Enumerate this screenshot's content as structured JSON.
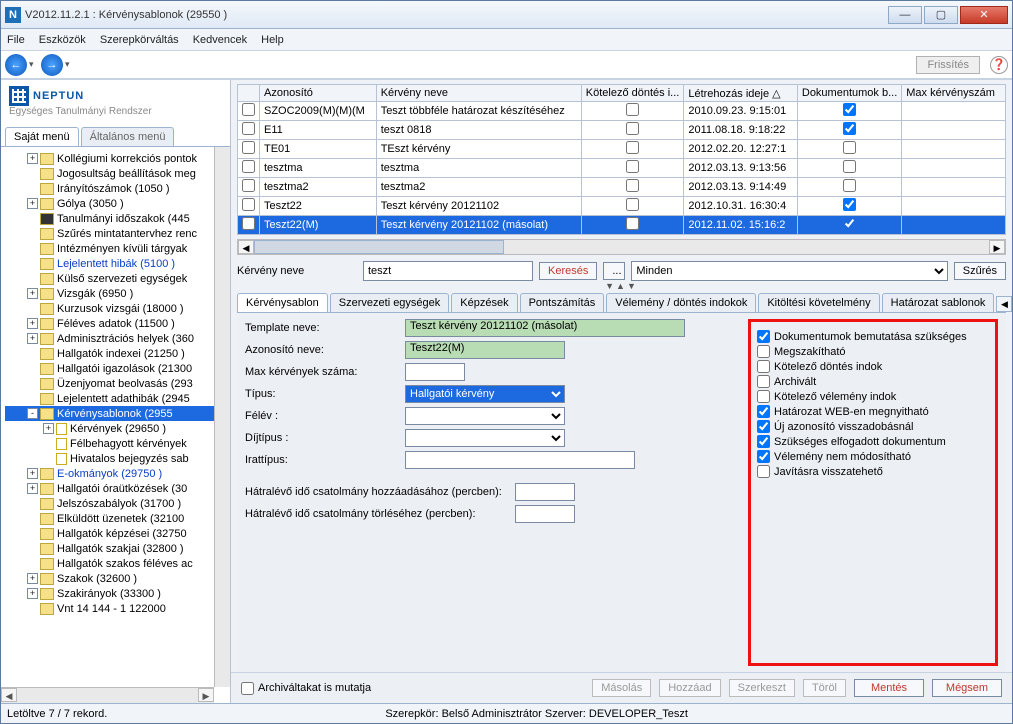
{
  "title": "V2012.11.2.1 : Kérvénysablonok (29550  )",
  "menu": [
    "File",
    "Eszközök",
    "Szerepkörváltás",
    "Kedvencek",
    "Help"
  ],
  "toolbar": {
    "refresh": "Frissítés"
  },
  "logo": {
    "name": "NEPTUN",
    "sub": "Egységes Tanulmányi Rendszer"
  },
  "left_tabs": [
    "Saját menü",
    "Általános menü"
  ],
  "tree": [
    {
      "pm": "+",
      "ic": "fld",
      "lbl": "Kollégiumi korrekciós pontok",
      "ind": 1
    },
    {
      "pm": "",
      "ic": "fld",
      "lbl": "Jogosultság beállítások meg",
      "ind": 1
    },
    {
      "pm": "",
      "ic": "fld",
      "lbl": "Irányítószámok (1050  )",
      "ind": 1
    },
    {
      "pm": "+",
      "ic": "fld",
      "lbl": "Gólya (3050  )",
      "ind": 1
    },
    {
      "pm": "",
      "ic": "blk",
      "lbl": "Tanulmányi időszakok (445",
      "ind": 1
    },
    {
      "pm": "",
      "ic": "fld",
      "lbl": "Szűrés mintatantervhez renc",
      "ind": 1
    },
    {
      "pm": "",
      "ic": "fld",
      "lbl": "Intézményen kívüli tárgyak",
      "ind": 1
    },
    {
      "pm": "",
      "ic": "fld",
      "lbl": "Lejelentett hibák (5100  )",
      "ind": 1,
      "blue": true
    },
    {
      "pm": "",
      "ic": "fld",
      "lbl": "Külső szervezeti egységek",
      "ind": 1
    },
    {
      "pm": "+",
      "ic": "fld",
      "lbl": "Vizsgák (6950  )",
      "ind": 1
    },
    {
      "pm": "",
      "ic": "fld",
      "lbl": "Kurzusok vizsgái (18000  )",
      "ind": 1
    },
    {
      "pm": "+",
      "ic": "fld",
      "lbl": "Féléves adatok (11500  )",
      "ind": 1
    },
    {
      "pm": "+",
      "ic": "fld",
      "lbl": "Adminisztrációs helyek (360",
      "ind": 1
    },
    {
      "pm": "",
      "ic": "fld",
      "lbl": "Hallgatók indexei (21250  )",
      "ind": 1
    },
    {
      "pm": "",
      "ic": "fld",
      "lbl": "Hallgatói igazolások (21300",
      "ind": 1
    },
    {
      "pm": "",
      "ic": "fld",
      "lbl": "Üzenjyomat beolvasás (293",
      "ind": 1
    },
    {
      "pm": "",
      "ic": "fld",
      "lbl": "Lejelentett adathibák (2945",
      "ind": 1
    },
    {
      "pm": "-",
      "ic": "fld",
      "lbl": "Kérvénysablonok (2955",
      "ind": 1,
      "sel": true
    },
    {
      "pm": "+",
      "ic": "pg",
      "lbl": "Kérvények (29650  )",
      "ind": 2
    },
    {
      "pm": "",
      "ic": "pg",
      "lbl": "Félbehagyott kérvények",
      "ind": 2
    },
    {
      "pm": "",
      "ic": "pg",
      "lbl": "Hivatalos bejegyzés sab",
      "ind": 2
    },
    {
      "pm": "+",
      "ic": "fld",
      "lbl": "E-okmányok (29750  )",
      "ind": 1,
      "blue": true
    },
    {
      "pm": "+",
      "ic": "fld",
      "lbl": "Hallgatói óraütközések (30",
      "ind": 1
    },
    {
      "pm": "",
      "ic": "fld",
      "lbl": "Jelszószabályok (31700  )",
      "ind": 1
    },
    {
      "pm": "",
      "ic": "fld",
      "lbl": "Elküldött üzenetek (32100",
      "ind": 1
    },
    {
      "pm": "",
      "ic": "fld",
      "lbl": "Hallgatók képzései (32750",
      "ind": 1
    },
    {
      "pm": "",
      "ic": "fld",
      "lbl": "Hallgatók szakjai (32800  )",
      "ind": 1
    },
    {
      "pm": "",
      "ic": "fld",
      "lbl": "Hallgatók szakos féléves ac",
      "ind": 1
    },
    {
      "pm": "+",
      "ic": "fld",
      "lbl": "Szakok (32600  )",
      "ind": 1
    },
    {
      "pm": "+",
      "ic": "fld",
      "lbl": "Szakirányok (33300  )",
      "ind": 1
    },
    {
      "pm": "",
      "ic": "fld",
      "lbl": "Vnt 14  144  -  1  122000",
      "ind": 1
    }
  ],
  "grid": {
    "cols": [
      "Azonosító",
      "Kérvény neve",
      "Kötelező döntés i...",
      "Létrehozás ideje  △",
      "Dokumentumok b...",
      "Max kérvényszám"
    ],
    "rows": [
      {
        "c0": "SZOC2009(M)(M)(M",
        "c1": "Teszt többféle határozat készítéséhez",
        "c2": false,
        "c3": "2010.09.23. 9:15:01",
        "c4": true,
        "c5": ""
      },
      {
        "c0": "E11",
        "c1": "teszt 0818",
        "c2": false,
        "c3": "2011.08.18. 9:18:22",
        "c4": true,
        "c5": ""
      },
      {
        "c0": "TE01",
        "c1": "TEszt kérvény",
        "c2": false,
        "c3": "2012.02.20. 12:27:1",
        "c4": false,
        "c5": ""
      },
      {
        "c0": "tesztma",
        "c1": "tesztma",
        "c2": false,
        "c3": "2012.03.13. 9:13:56",
        "c4": false,
        "c5": ""
      },
      {
        "c0": "tesztma2",
        "c1": "tesztma2",
        "c2": false,
        "c3": "2012.03.13. 9:14:49",
        "c4": false,
        "c5": ""
      },
      {
        "c0": "Teszt22",
        "c1": "Teszt kérvény 20121102",
        "c2": false,
        "c3": "2012.10.31. 16:30:4",
        "c4": true,
        "c5": ""
      },
      {
        "c0": "Teszt22(M)",
        "c1": "Teszt kérvény 20121102 (másolat)",
        "c2": false,
        "c3": "2012.11.02. 15:16:2",
        "c4": true,
        "c5": "",
        "sel": true
      }
    ]
  },
  "filter": {
    "label": "Kérvény neve",
    "value": "teszt",
    "search": "Keresés",
    "dots": "...",
    "combo": "Minden",
    "szures": "Szűrés"
  },
  "inner_tabs": [
    "Kérvénysablon",
    "Szervezeti egységek",
    "Képzések",
    "Pontszámítás",
    "Vélemény / döntés indokok",
    "Kitöltési követelmény",
    "Határozat sablonok"
  ],
  "form": {
    "template_lbl": "Template neve:",
    "template_val": "Teszt kérvény 20121102 (másolat)",
    "azon_lbl": "Azonosító neve:",
    "azon_val": "Teszt22(M)",
    "max_lbl": "Max kérvények száma:",
    "tipus_lbl": "Típus:",
    "tipus_val": "Hallgatói kérvény",
    "felev_lbl": "Félév :",
    "dij_lbl": "Díjtípus :",
    "irat_lbl": "Irattípus:",
    "h1_lbl": "Hátralévő idő csatolmány hozzáadásához (percben):",
    "h2_lbl": "Hátralévő idő csatolmány törléséhez (percben):"
  },
  "chks": [
    {
      "c": true,
      "l": "Dokumentumok bemutatása szükséges"
    },
    {
      "c": false,
      "l": "Megszakítható"
    },
    {
      "c": false,
      "l": "Kötelező döntés indok"
    },
    {
      "c": false,
      "l": "Archivált"
    },
    {
      "c": false,
      "l": "Kötelező vélemény indok"
    },
    {
      "c": true,
      "l": "Határozat WEB-en megnyitható"
    },
    {
      "c": true,
      "l": "Új azonosító visszadobásnál"
    },
    {
      "c": true,
      "l": "Szükséges elfogadott dokumentum"
    },
    {
      "c": true,
      "l": "Vélemény nem módosítható"
    },
    {
      "c": false,
      "l": "Javításra visszatehető"
    }
  ],
  "bottom": {
    "arch": "Archiváltakat is mutatja",
    "b1": "Másolás",
    "b2": "Hozzáad",
    "b3": "Szerkeszt",
    "b4": "Töröl",
    "b5": "Mentés",
    "b6": "Mégsem"
  },
  "status": {
    "left": "Letöltve 7 / 7 rekord.",
    "mid": "Szerepkör: Belső Adminisztrátor   Szerver: DEVELOPER_Teszt"
  }
}
